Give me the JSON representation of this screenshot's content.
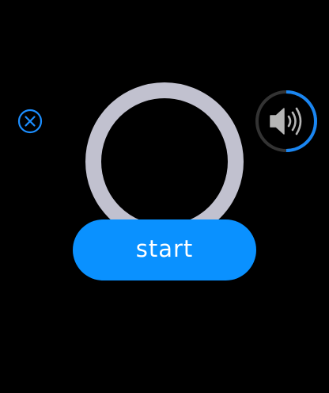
{
  "start_button": {
    "label": "start"
  },
  "close_button": {
    "icon": "close-circle-icon"
  },
  "ring": {
    "icon": "ring-indicator"
  },
  "volume": {
    "icon": "speaker-volume-icon",
    "level": 0.5
  },
  "colors": {
    "background": "#000000",
    "accent": "#0a91ff",
    "ring": "#c1c1cf",
    "volume_track": "#333333",
    "speaker": "#b5b5b5"
  }
}
